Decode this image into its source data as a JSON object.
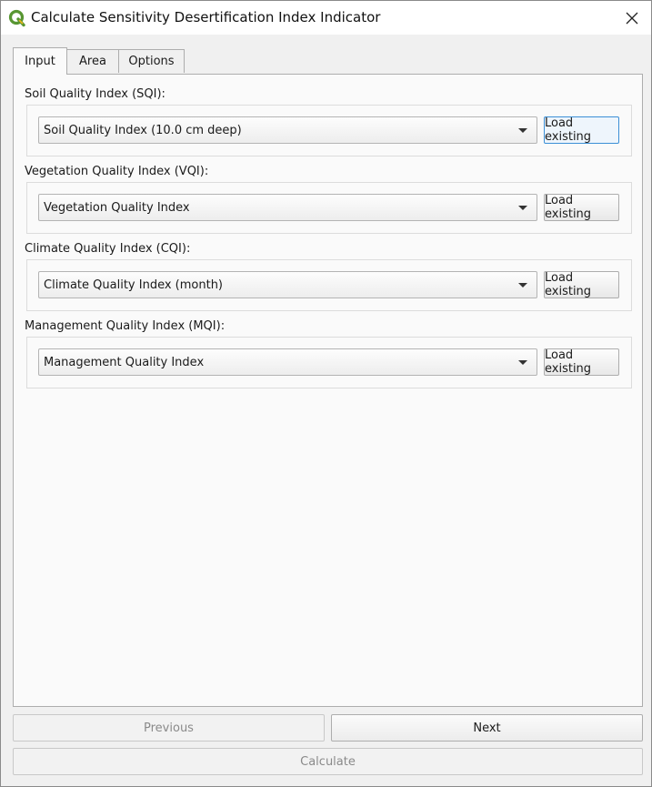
{
  "window": {
    "title": "Calculate Sensitivity Desertification Index Indicator"
  },
  "icons": {
    "app": "qgis-logo-icon",
    "close": "close-icon",
    "dropdown": "chevron-down-icon"
  },
  "tabs": [
    {
      "label": "Input",
      "active": true
    },
    {
      "label": "Area",
      "active": false
    },
    {
      "label": "Options",
      "active": false
    }
  ],
  "sections": [
    {
      "label": "Soil Quality Index (SQI):",
      "selected": "Soil Quality Index (10.0 cm deep)",
      "button": "Load existing"
    },
    {
      "label": "Vegetation Quality Index (VQI):",
      "selected": "Vegetation Quality Index",
      "button": "Load existing"
    },
    {
      "label": "Climate Quality Index (CQI):",
      "selected": "Climate Quality Index (month)",
      "button": "Load existing"
    },
    {
      "label": "Management Quality Index (MQI):",
      "selected": "Management Quality Index",
      "button": "Load existing"
    }
  ],
  "footer": {
    "previous": "Previous",
    "next": "Next",
    "calculate": "Calculate"
  },
  "colors": {
    "focus_border": "#3c8fd6",
    "logo_green": "#589632",
    "logo_yellow": "#f0b71c"
  }
}
